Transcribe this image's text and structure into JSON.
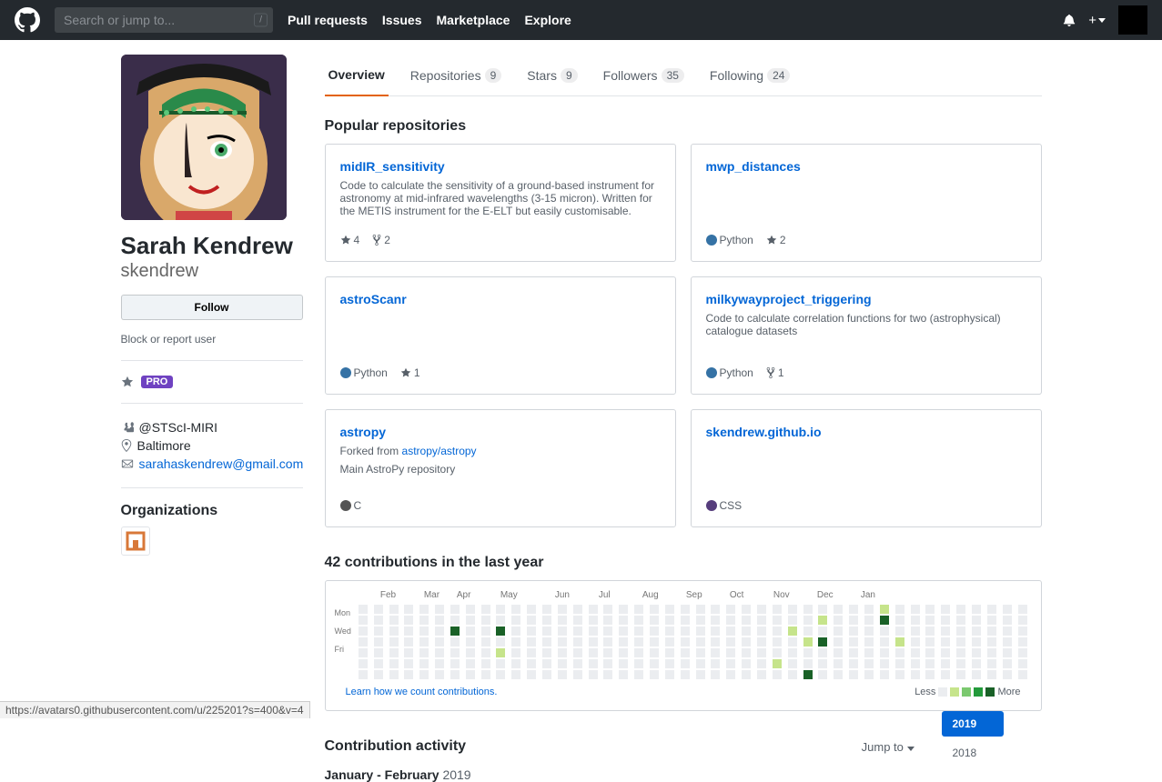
{
  "header": {
    "search_placeholder": "Search or jump to...",
    "slash": "/",
    "nav": [
      "Pull requests",
      "Issues",
      "Marketplace",
      "Explore"
    ],
    "plus_dropdown": "+"
  },
  "profile": {
    "name": "Sarah Kendrew",
    "username": "skendrew",
    "follow_btn": "Follow",
    "block_report": "Block or report user",
    "pro_label": "PRO",
    "org_handle": "@STScI-MIRI",
    "location": "Baltimore",
    "email": "sarahaskendrew@gmail.com",
    "orgs_title": "Organizations"
  },
  "tabs": {
    "overview": "Overview",
    "repositories": "Repositories",
    "repositories_count": "9",
    "stars": "Stars",
    "stars_count": "9",
    "followers": "Followers",
    "followers_count": "35",
    "following": "Following",
    "following_count": "24"
  },
  "popular": {
    "title": "Popular repositories",
    "repos": [
      {
        "name": "midIR_sensitivity",
        "desc": "Code to calculate the sensitivity of a ground-based instrument for astronomy at mid-infrared wavelengths (3-15 micron). Written for the METIS instrument for the E-ELT but easily customisable.",
        "stars": "4",
        "forks": "2",
        "lang": "",
        "lang_color": ""
      },
      {
        "name": "mwp_distances",
        "desc": "",
        "lang": "Python",
        "lang_color": "#3572A5",
        "stars": "2"
      },
      {
        "name": "astroScanr",
        "desc": "",
        "lang": "Python",
        "lang_color": "#3572A5",
        "stars": "1"
      },
      {
        "name": "milkywayproject_triggering",
        "desc": "Code to calculate correlation functions for two (astrophysical) catalogue datasets",
        "lang": "Python",
        "lang_color": "#3572A5",
        "forks": "1"
      },
      {
        "name": "astropy",
        "forked_from_label": "Forked from ",
        "forked_from": "astropy/astropy",
        "desc": "Main AstroPy repository",
        "lang": "C",
        "lang_color": "#555555"
      },
      {
        "name": "skendrew.github.io",
        "desc": "",
        "lang": "CSS",
        "lang_color": "#563d7c"
      }
    ]
  },
  "contrib": {
    "title": "42 contributions in the last year",
    "months": [
      "Feb",
      "Mar",
      "Apr",
      "May",
      "Jun",
      "Jul",
      "Aug",
      "Sep",
      "Oct",
      "Nov",
      "Dec",
      "Jan"
    ],
    "days": [
      "Mon",
      "Wed",
      "Fri"
    ],
    "learn_link": "Learn how we count contributions.",
    "less": "Less",
    "more": "More"
  },
  "activity": {
    "title": "Contribution activity",
    "jump_to": "Jump to ",
    "period_range": "January - February ",
    "period_year": "2019"
  },
  "years": {
    "y2019": "2019",
    "y2018": "2018"
  },
  "status_url": "https://avatars0.githubusercontent.com/u/225201?s=400&v=4"
}
